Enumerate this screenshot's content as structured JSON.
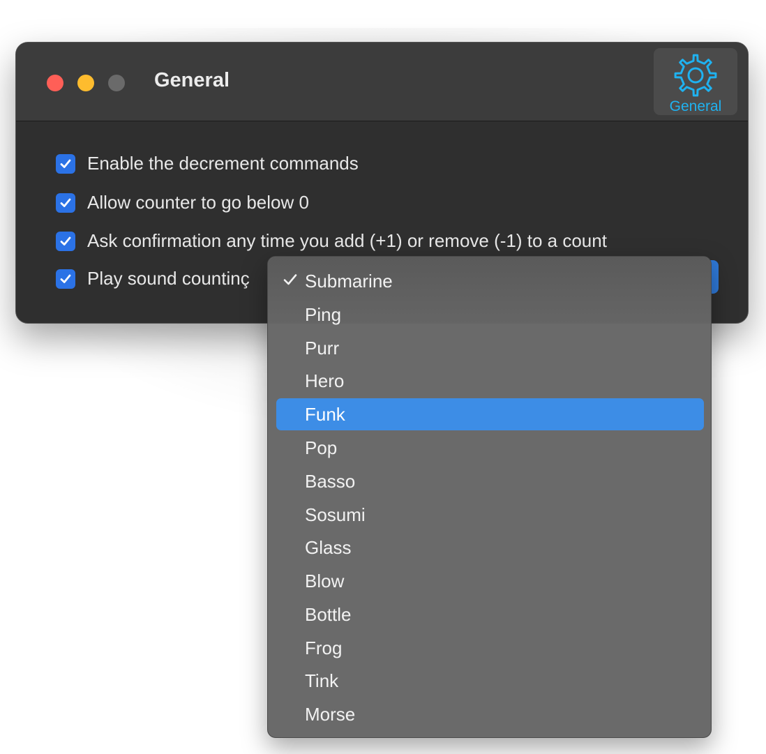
{
  "window": {
    "title": "General",
    "toolbar_tab_label": "General"
  },
  "settings": {
    "options": [
      {
        "label": "Enable the decrement commands",
        "checked": true
      },
      {
        "label": "Allow counter to go below 0",
        "checked": true
      },
      {
        "label": "Ask confirmation any time you add (+1) or remove (-1) to a count",
        "checked": true
      },
      {
        "label": "Play sound countinç",
        "checked": true
      }
    ]
  },
  "sound_menu": {
    "selected": "Submarine",
    "highlighted": "Funk",
    "items": [
      "Submarine",
      "Ping",
      "Purr",
      "Hero",
      "Funk",
      "Pop",
      "Basso",
      "Sosumi",
      "Glass",
      "Blow",
      "Bottle",
      "Frog",
      "Tink",
      "Morse"
    ]
  },
  "colors": {
    "accent": "#1fb2f0",
    "checkbox": "#2b72e6",
    "highlight": "#3d8de6",
    "close": "#ff5f57",
    "minimize": "#febc2e",
    "zoom_disabled": "#6a6a6a"
  },
  "icons": {
    "toolbar": "gear-icon",
    "selected_item": "checkmark-icon"
  }
}
